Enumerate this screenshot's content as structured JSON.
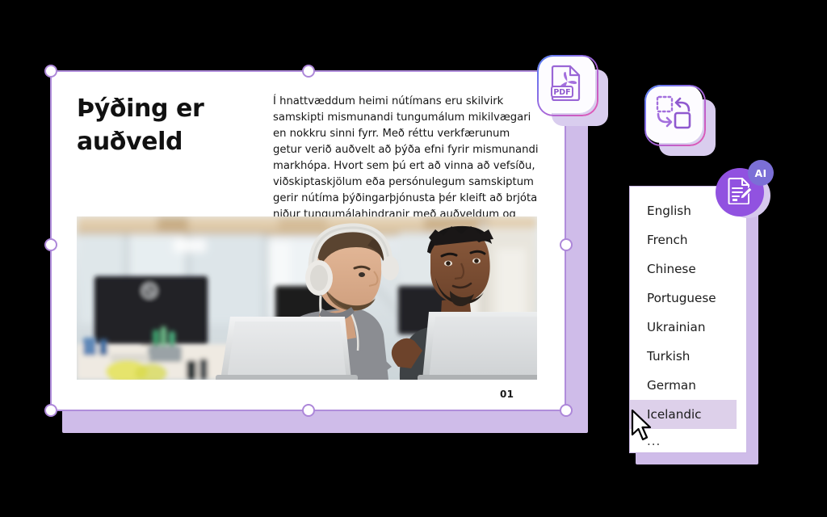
{
  "slide": {
    "title": "Þýðing er\nauðveld",
    "body": "Í hnattvæddum heimi nútímans eru skilvirk samskipti mismunandi tungumálum mikilvægari en nokkru sinni fyrr. Með réttu verkfærunum getur verið auðvelt að þýða efni fyrir mismunandi markhópa. Hvort sem þú ert að vinna að vefsíðu, viðskiptaskjölum eða persónulegum samskiptum gerir nútíma þýðingarþjónusta þér kleift að brjóta niður tungumálahindranir með auðveldum og nákvæmni.",
    "page_number": "01",
    "photo_alt": "two-colleagues-office-laptops-photo"
  },
  "tool_cards": [
    {
      "id": "pdf",
      "icon": "pdf-file-icon",
      "label": "PDF"
    },
    {
      "id": "convert",
      "icon": "convert-swap-icon",
      "label": ""
    }
  ],
  "ai_badge": {
    "icon": "document-edit-icon",
    "label": "AI"
  },
  "language_dropdown": {
    "name": "language-list",
    "items": [
      {
        "label": "English",
        "selected": false
      },
      {
        "label": "French",
        "selected": false
      },
      {
        "label": "Chinese",
        "selected": false
      },
      {
        "label": "Portuguese",
        "selected": false
      },
      {
        "label": "Ukrainian",
        "selected": false
      },
      {
        "label": "Turkish",
        "selected": false
      },
      {
        "label": "German",
        "selected": false
      },
      {
        "label": "Icelandic",
        "selected": true
      },
      {
        "label": "...",
        "selected": false
      }
    ]
  },
  "colors": {
    "background": "#000000",
    "slide_paper": "#ffffff",
    "accent_purple": "#cfbce9",
    "selection_border": "#b08ddb",
    "highlight": "#ddd0ea",
    "ai_purple": "#9152e0",
    "ai_badge": "#7b6fd6"
  }
}
